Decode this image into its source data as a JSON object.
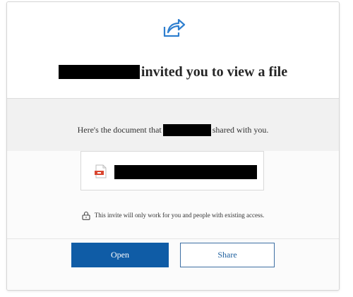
{
  "header": {
    "icon": "share-arrow-icon",
    "headline_suffix": "invited you to view a file",
    "accent_color": "#2f7fcf"
  },
  "message": {
    "before": "Here's the document that",
    "after": "shared with you."
  },
  "file": {
    "icon": "pdf-file-icon"
  },
  "notice": {
    "icon": "lock-icon",
    "text": "This invite will only work for you and people with existing access."
  },
  "actions": {
    "open_label": "Open",
    "share_label": "Share",
    "primary_color": "#0f5ca6"
  }
}
